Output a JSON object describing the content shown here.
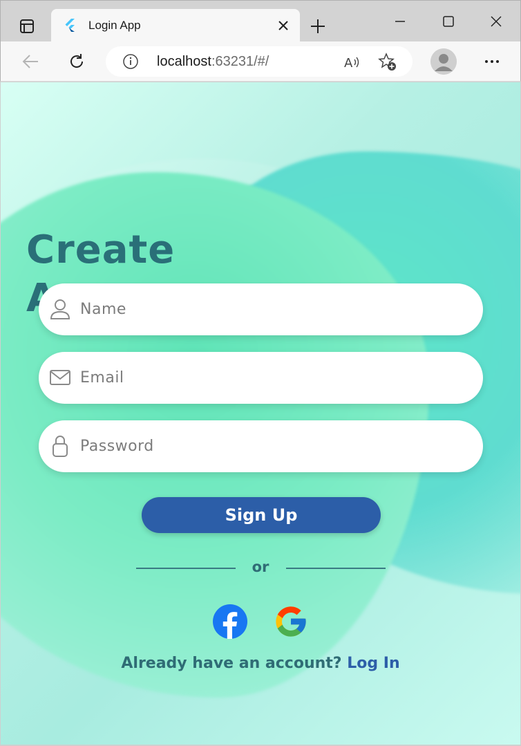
{
  "browser": {
    "tab_title": "Login App",
    "url_host": "localhost",
    "url_rest": ":63231/#/",
    "icons": {
      "tabs": "tab-actions-icon",
      "close_tab": "close-icon",
      "new_tab": "plus-icon",
      "minimize": "minimize-icon",
      "maximize": "maximize-icon",
      "close_window": "close-icon",
      "back": "back-arrow-icon",
      "refresh": "refresh-icon",
      "site_info": "info-icon",
      "read_aloud": "read-aloud-icon",
      "favorites": "add-favorite-icon",
      "profile": "profile-icon",
      "more": "more-icon"
    }
  },
  "page": {
    "headline_line1": "Create",
    "headline_line2": "A",
    "fields": {
      "name_placeholder": "Name",
      "email_placeholder": "Email",
      "password_placeholder": "Password"
    },
    "signup_label": "Sign Up",
    "or_label": "or",
    "social": [
      "facebook",
      "google"
    ],
    "already_text": "Already have an account?",
    "login_link": "Log In",
    "colors": {
      "primary": "#2c5ea8",
      "text": "#2f6c75",
      "headline": "#2a6f78"
    }
  }
}
